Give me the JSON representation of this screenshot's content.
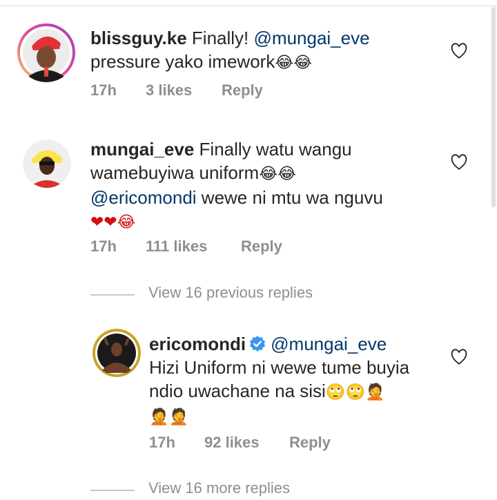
{
  "comments": [
    {
      "username": "blissguy.ke",
      "text": "Finally!",
      "mention": "@mungai_eve",
      "line2": "pressure yako imework",
      "emoji": "😂😂",
      "time": "17h",
      "likes": "3 likes",
      "reply": "Reply"
    },
    {
      "username": "mungai_eve",
      "text_line1": "Finally watu wangu",
      "text_line2": "wamebuyiwa uniform",
      "emoji_line2": "😂😂",
      "mention": "@ericomondi",
      "text_line3": " wewe ni mtu wa nguvu",
      "emoji_line4": "❤❤😂",
      "time": "17h",
      "likes": "111 likes",
      "reply": "Reply"
    }
  ],
  "view_previous": "View 16 previous replies",
  "reply_comment": {
    "username": "ericomondi",
    "mention": "@mungai_eve",
    "text_line1": "Hizi Uniform ni wewe tume buyia",
    "text_line2": "ndio uwachane na sisi",
    "emoji_line2": "🙄🙄🤦",
    "emoji_line3": "🤦🤦",
    "time": "17h",
    "likes": "92 likes",
    "reply": "Reply"
  },
  "view_more": "View 16 more replies",
  "colors": {
    "mention": "#00376b",
    "meta": "#8e8e8e",
    "verified": "#3897f0",
    "avatar_ring": "#d6249f"
  },
  "icons": [
    "heart-outline-icon",
    "verified-badge-icon"
  ]
}
